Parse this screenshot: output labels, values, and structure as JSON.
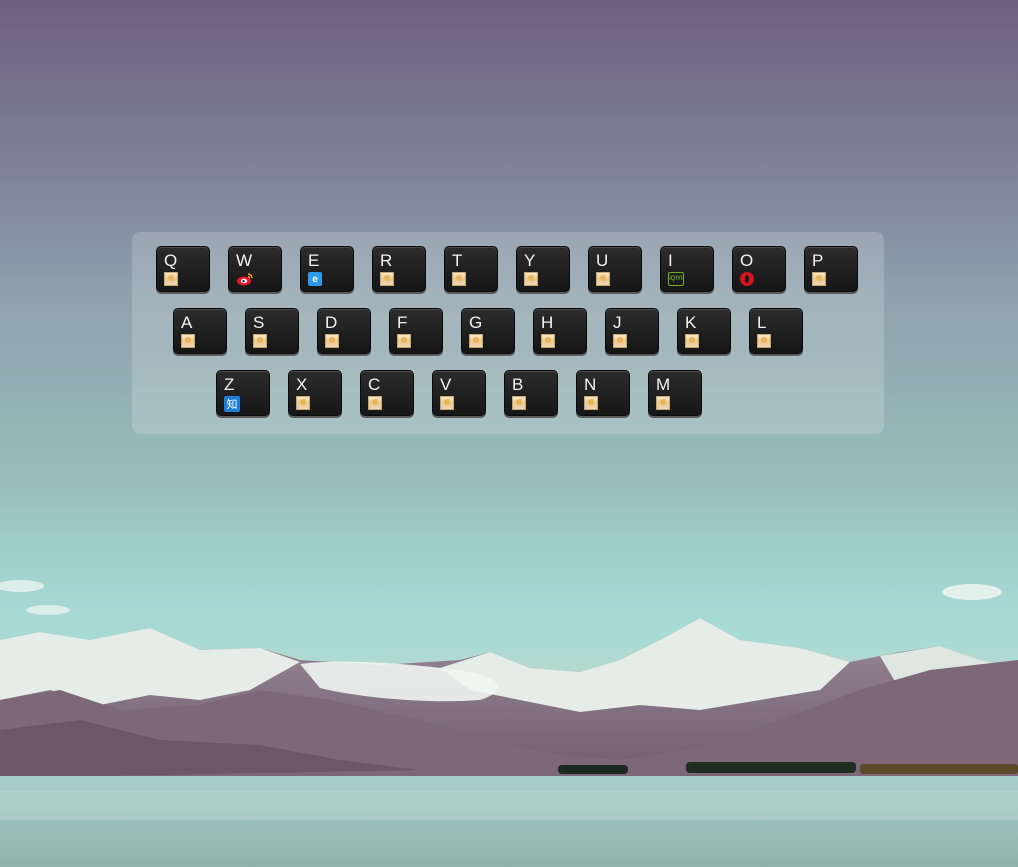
{
  "keyboard": {
    "rows": [
      [
        {
          "letter": "Q",
          "icon": "site-favicon"
        },
        {
          "letter": "W",
          "icon": "weibo-icon"
        },
        {
          "letter": "E",
          "icon": "browser-e-icon"
        },
        {
          "letter": "R",
          "icon": "site-favicon"
        },
        {
          "letter": "T",
          "icon": "site-favicon"
        },
        {
          "letter": "Y",
          "icon": "site-favicon"
        },
        {
          "letter": "U",
          "icon": "site-favicon"
        },
        {
          "letter": "I",
          "icon": "iqiyi-icon",
          "icon_text": "iQIYI"
        },
        {
          "letter": "O",
          "icon": "opera-icon"
        },
        {
          "letter": "P",
          "icon": "site-favicon"
        }
      ],
      [
        {
          "letter": "A",
          "icon": "site-favicon"
        },
        {
          "letter": "S",
          "icon": "site-favicon"
        },
        {
          "letter": "D",
          "icon": "site-favicon"
        },
        {
          "letter": "F",
          "icon": "site-favicon"
        },
        {
          "letter": "G",
          "icon": "site-favicon"
        },
        {
          "letter": "H",
          "icon": "site-favicon"
        },
        {
          "letter": "J",
          "icon": "site-favicon"
        },
        {
          "letter": "K",
          "icon": "site-favicon"
        },
        {
          "letter": "L",
          "icon": "site-favicon"
        }
      ],
      [
        {
          "letter": "Z",
          "icon": "zhihu-icon",
          "icon_text": "知"
        },
        {
          "letter": "X",
          "icon": "site-favicon"
        },
        {
          "letter": "C",
          "icon": "site-favicon"
        },
        {
          "letter": "V",
          "icon": "site-favicon"
        },
        {
          "letter": "B",
          "icon": "site-favicon"
        },
        {
          "letter": "N",
          "icon": "site-favicon"
        },
        {
          "letter": "M",
          "icon": "site-favicon"
        }
      ]
    ]
  },
  "background": {
    "image": "mountain-lake-landscape",
    "colors": {
      "sky_top": "#6e5f80",
      "sky_mid": "#98bcbb",
      "water": "#9fc4bc",
      "snow": "#e8eee8",
      "mountain": "#7d6a78"
    }
  }
}
